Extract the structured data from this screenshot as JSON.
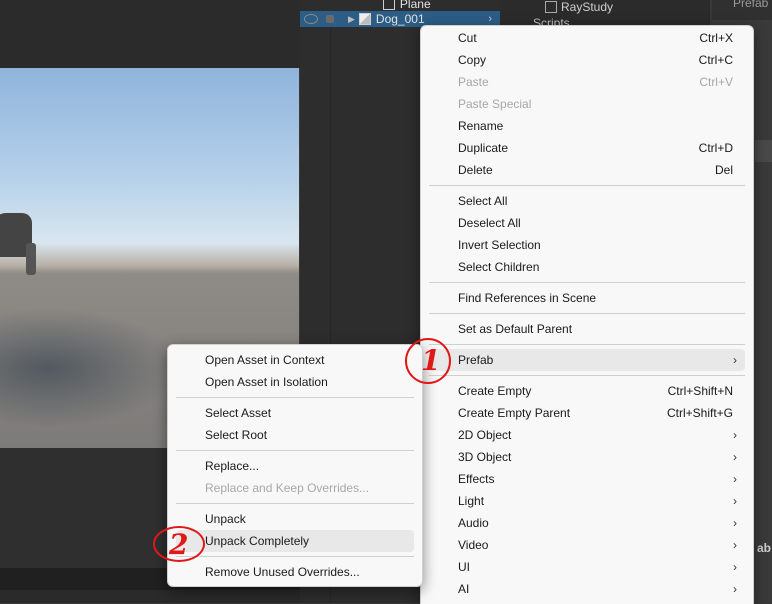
{
  "hierarchy": {
    "items": [
      {
        "label": "Plane",
        "selected": false
      },
      {
        "label": "Dog_001",
        "selected": true
      }
    ]
  },
  "project": {
    "root_label": "RayStudy",
    "scripts_label": "Scripts"
  },
  "inspector": {
    "header_fragment": "Prefab",
    "side_fragment": "ab"
  },
  "context_menu": {
    "items": [
      {
        "label": "Cut",
        "shortcut": "Ctrl+X",
        "enabled": true
      },
      {
        "label": "Copy",
        "shortcut": "Ctrl+C",
        "enabled": true
      },
      {
        "label": "Paste",
        "shortcut": "Ctrl+V",
        "enabled": false
      },
      {
        "label": "Paste Special",
        "shortcut": "",
        "enabled": false
      },
      {
        "label": "Rename",
        "shortcut": "",
        "enabled": true
      },
      {
        "label": "Duplicate",
        "shortcut": "Ctrl+D",
        "enabled": true
      },
      {
        "label": "Delete",
        "shortcut": "Del",
        "enabled": true
      },
      {
        "label": "Select All",
        "shortcut": "",
        "enabled": true
      },
      {
        "label": "Deselect All",
        "shortcut": "",
        "enabled": true
      },
      {
        "label": "Invert Selection",
        "shortcut": "",
        "enabled": true
      },
      {
        "label": "Select Children",
        "shortcut": "",
        "enabled": true
      },
      {
        "label": "Find References in Scene",
        "shortcut": "",
        "enabled": true
      },
      {
        "label": "Set as Default Parent",
        "shortcut": "",
        "enabled": true
      },
      {
        "label": "Prefab",
        "shortcut": "",
        "enabled": true,
        "submenu": true,
        "highlighted": true
      },
      {
        "label": "Create Empty",
        "shortcut": "Ctrl+Shift+N",
        "enabled": true
      },
      {
        "label": "Create Empty Parent",
        "shortcut": "Ctrl+Shift+G",
        "enabled": true
      },
      {
        "label": "2D Object",
        "shortcut": "",
        "enabled": true,
        "submenu": true
      },
      {
        "label": "3D Object",
        "shortcut": "",
        "enabled": true,
        "submenu": true
      },
      {
        "label": "Effects",
        "shortcut": "",
        "enabled": true,
        "submenu": true
      },
      {
        "label": "Light",
        "shortcut": "",
        "enabled": true,
        "submenu": true
      },
      {
        "label": "Audio",
        "shortcut": "",
        "enabled": true,
        "submenu": true
      },
      {
        "label": "Video",
        "shortcut": "",
        "enabled": true,
        "submenu": true
      },
      {
        "label": "UI",
        "shortcut": "",
        "enabled": true,
        "submenu": true
      },
      {
        "label": "AI",
        "shortcut": "",
        "enabled": true,
        "submenu": true
      }
    ]
  },
  "prefab_submenu": {
    "items": [
      {
        "label": "Open Asset in Context",
        "enabled": true
      },
      {
        "label": "Open Asset in Isolation",
        "enabled": true
      },
      {
        "label": "Select Asset",
        "enabled": true
      },
      {
        "label": "Select Root",
        "enabled": true
      },
      {
        "label": "Replace...",
        "enabled": true
      },
      {
        "label": "Replace and Keep Overrides...",
        "enabled": false
      },
      {
        "label": "Unpack",
        "enabled": true
      },
      {
        "label": "Unpack Completely",
        "enabled": true,
        "highlighted": true
      },
      {
        "label": "Remove Unused Overrides...",
        "enabled": true
      }
    ]
  },
  "annotations": {
    "step1": "1",
    "step2": "2",
    "color": "#e01818"
  },
  "icons": {
    "submenu_arrow": "›",
    "hierarchy_expand": "▶",
    "row_chevron": "›"
  }
}
